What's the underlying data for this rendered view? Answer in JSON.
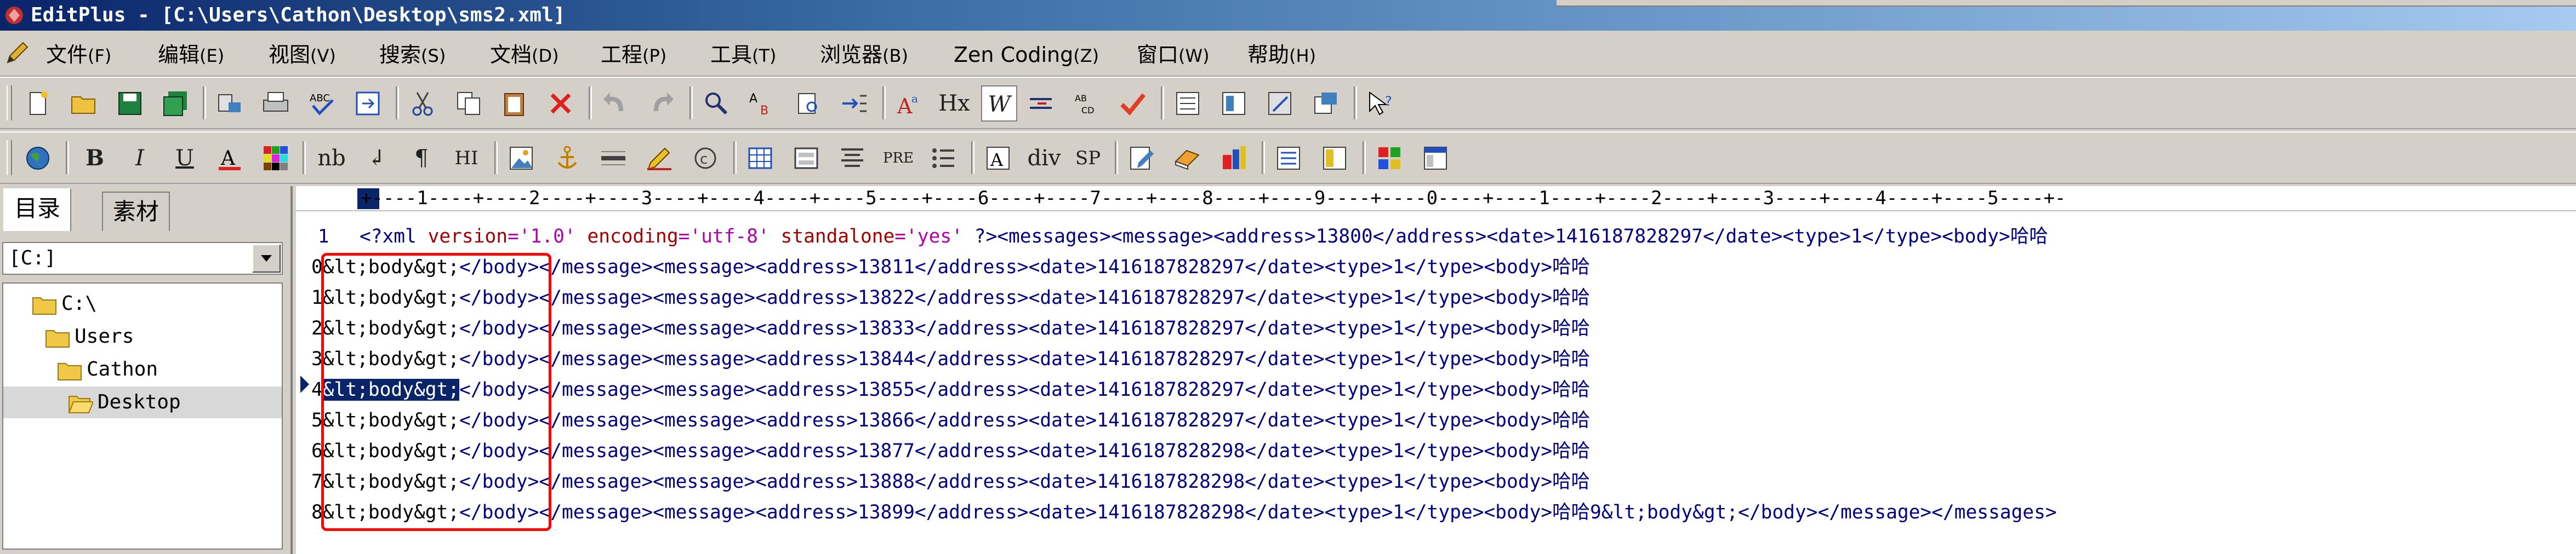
{
  "window": {
    "title": "EditPlus - [C:\\Users\\Cathon\\Desktop\\sms2.xml]"
  },
  "menu": [
    {
      "label": "文件",
      "shortcut": "(F)"
    },
    {
      "label": "编辑",
      "shortcut": "(E)"
    },
    {
      "label": "视图",
      "shortcut": "(V)"
    },
    {
      "label": "搜索",
      "shortcut": "(S)"
    },
    {
      "label": "文档",
      "shortcut": "(D)"
    },
    {
      "label": "工程",
      "shortcut": "(P)"
    },
    {
      "label": "工具",
      "shortcut": "(T)"
    },
    {
      "label": "浏览器",
      "shortcut": "(B)"
    },
    {
      "label": "Zen Coding",
      "shortcut": "(Z)"
    },
    {
      "label": "窗口",
      "shortcut": "(W)"
    },
    {
      "label": "帮助",
      "shortcut": "(H)"
    }
  ],
  "toolbar2_text": {
    "nb": "nb",
    "hi": "HI",
    "pre": "PRE",
    "div": "div",
    "sp": "SP",
    "hx": "Hx",
    "w": "W"
  },
  "left_panel": {
    "tabs": [
      "目录",
      "素材"
    ],
    "drive": "[C:]",
    "tree": [
      "C:\\",
      "Users",
      "Cathon",
      "Desktop"
    ]
  },
  "ruler": "+----1----+----2----+----3----+----4----+----5----+----6----+----7----+----8----+----9----+----0----+----1----+----2----+----3----+----4----+----5----+-",
  "editor": {
    "line_number": "1",
    "first_line": {
      "pi": "<?xml ",
      "a1": "version",
      "v1": "='1.0' ",
      "a2": "encoding",
      "v2": "='utf-8' ",
      "a3": "standalone",
      "v3": "='yes' ",
      "rest": "?><messages><message><address>13800</address><date>1416187828297</date><type>1</type><body>哈哈"
    },
    "rows": [
      {
        "n": "0",
        "ent": "&lt;body&gt;",
        "rest": "</body></message><message><address>13811</address><date>1416187828297</date><type>1</type><body>哈哈"
      },
      {
        "n": "1",
        "ent": "&lt;body&gt;",
        "rest": "</body></message><message><address>13822</address><date>1416187828297</date><type>1</type><body>哈哈"
      },
      {
        "n": "2",
        "ent": "&lt;body&gt;",
        "rest": "</body></message><message><address>13833</address><date>1416187828297</date><type>1</type><body>哈哈"
      },
      {
        "n": "3",
        "ent": "&lt;body&gt;",
        "rest": "</body></message><message><address>13844</address><date>1416187828297</date><type>1</type><body>哈哈"
      },
      {
        "n": "4",
        "ent": "&lt;body&gt;",
        "rest": "</body></message><message><address>13855</address><date>1416187828297</date><type>1</type><body>哈哈"
      },
      {
        "n": "5",
        "ent": "&lt;body&gt;",
        "rest": "</body></message><message><address>13866</address><date>1416187828297</date><type>1</type><body>哈哈"
      },
      {
        "n": "6",
        "ent": "&lt;body&gt;",
        "rest": "</body></message><message><address>13877</address><date>1416187828298</date><type>1</type><body>哈哈"
      },
      {
        "n": "7",
        "ent": "&lt;body&gt;",
        "rest": "</body></message><message><address>13888</address><date>1416187828298</date><type>1</type><body>哈哈"
      },
      {
        "n": "8",
        "ent": "&lt;body&gt;",
        "rest": "</body></message><message><address>13899</address><date>1416187828298</date><type>1</type><body>哈哈9&lt;body&gt;</body></message></messages>"
      }
    ],
    "selected_row": 4
  },
  "colors": {
    "title_bar": "#0a246a",
    "selection": "#0a246a",
    "annotation_box": "#ff0000",
    "tag": "#000080",
    "attribute": "#a00000",
    "attribute_value": "#b000b0"
  }
}
